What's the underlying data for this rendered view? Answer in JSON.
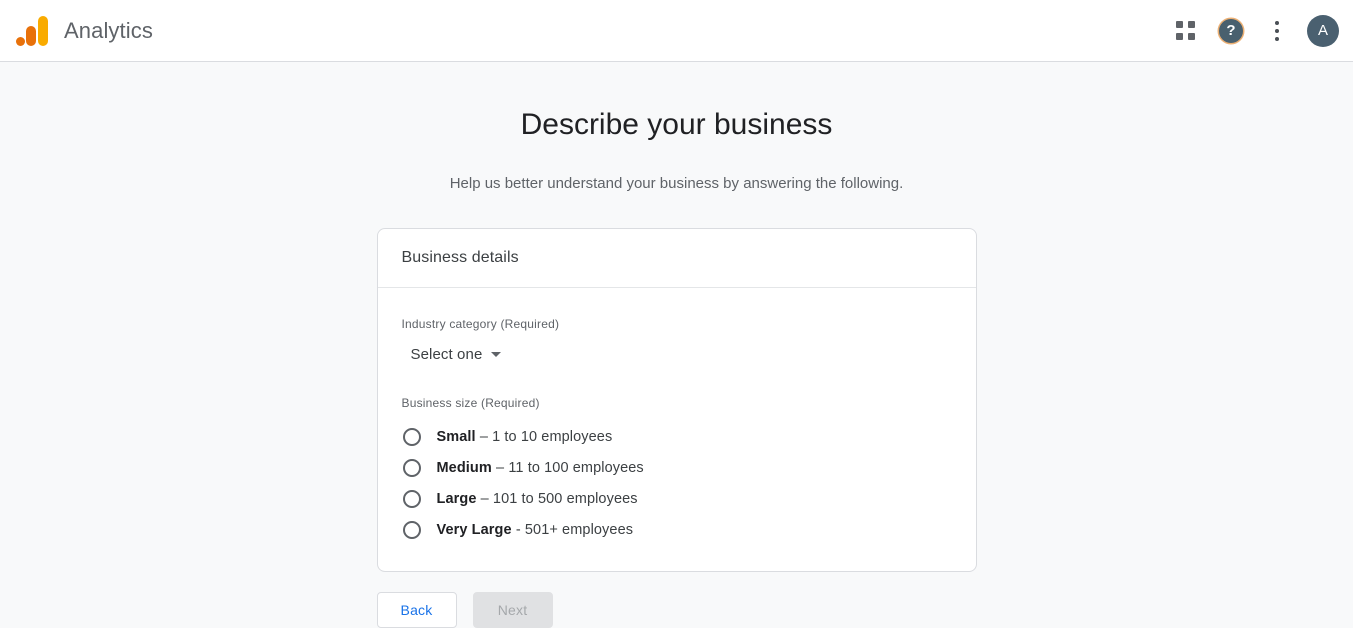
{
  "appbar": {
    "logo_icon": "google-analytics-logo",
    "brand_title": "Analytics",
    "apps_icon": "apps-grid-icon",
    "help_icon": "help-question-icon",
    "help_glyph": "?",
    "more_icon": "more-vert-icon",
    "avatar_initial": "A",
    "colors": {
      "logo_amber": "#f9ab00",
      "logo_orange": "#e8710a",
      "avatar_bg": "#4a6070",
      "help_bg": "#49606e",
      "help_ring": "#e69646"
    }
  },
  "page": {
    "title": "Describe your business",
    "subtitle": "Help us better understand your business by answering the following."
  },
  "card": {
    "header_title": "Business details",
    "industry": {
      "label": "Industry category (Required)",
      "dropdown_value": "Select one",
      "caret_icon": "chevron-down-icon"
    },
    "business_size": {
      "label": "Business size (Required)",
      "options": [
        {
          "name": "Small",
          "detail": "– 1 to 10 employees",
          "selected": false
        },
        {
          "name": "Medium",
          "detail": "– 11 to 100 employees",
          "selected": false
        },
        {
          "name": "Large",
          "detail": "– 101 to 500 employees",
          "selected": false
        },
        {
          "name": "Very Large",
          "detail": "- 501+ employees",
          "selected": false
        }
      ]
    }
  },
  "footer": {
    "back_label": "Back",
    "next_label": "Next",
    "next_disabled": true,
    "back_color": "#1a73e8"
  }
}
